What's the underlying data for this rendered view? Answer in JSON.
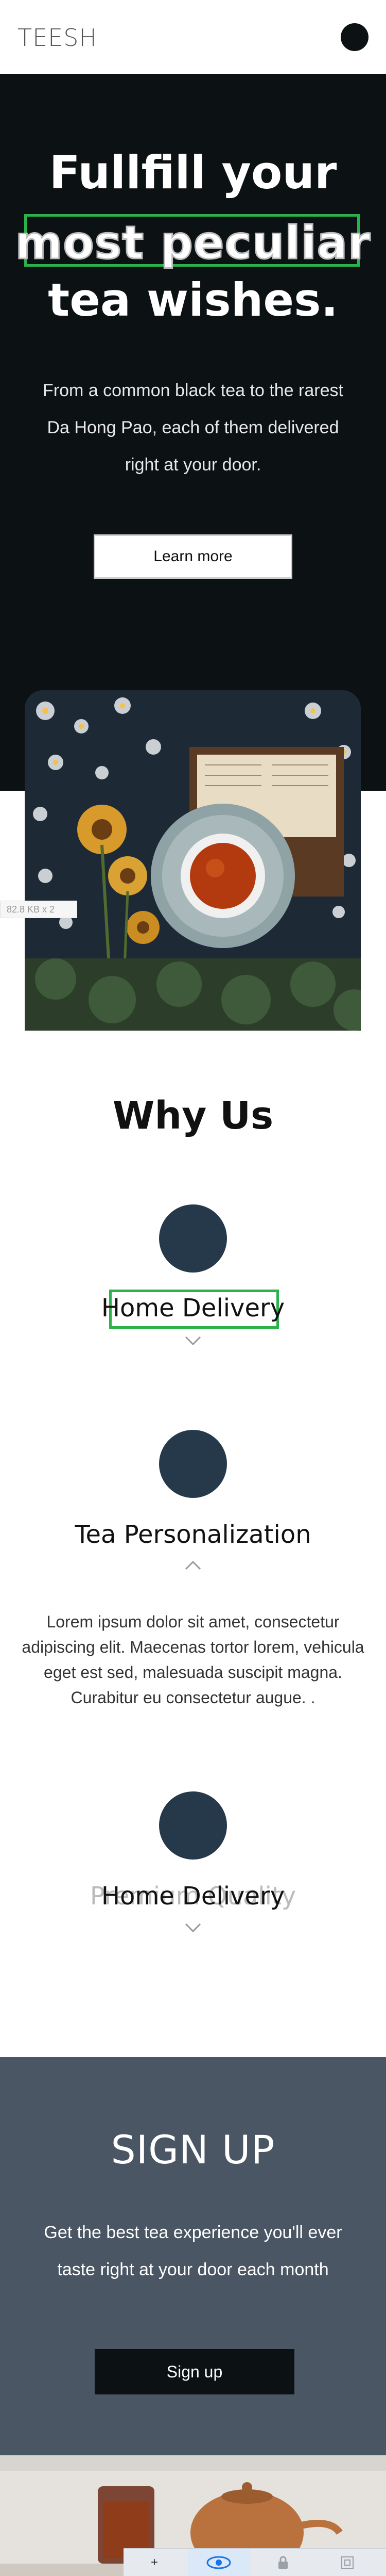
{
  "header": {
    "logo": "TEESH",
    "menu_icon": "circle-menu-icon"
  },
  "hero": {
    "title_line1": "Fullfill your",
    "title_line2": "most  peculiar",
    "title_line3": "tea wishes.",
    "subtitle": "From a common black tea to the rarest Da Hong Pao, each of them delivered right at your door.",
    "cta_label": "Learn more"
  },
  "overlay": {
    "size_label": "82.8 KB x 2"
  },
  "why_us": {
    "title": "Why Us",
    "features": [
      {
        "title": "Home Delivery",
        "expanded": false
      },
      {
        "title": "Tea Personalization",
        "expanded": true,
        "description": "Lorem ipsum dolor sit amet, consectetur adipiscing elit. Maecenas tortor lorem, vehicula eget est sed, malesuada suscipit magna. Curabitur eu consectetur augue. ."
      },
      {
        "title": "Home Delivery",
        "ghost_title": "Premium Quality",
        "expanded": false
      }
    ]
  },
  "signup": {
    "title": "SIGN UP",
    "subtitle": "Get the best tea experience you'll ever taste right at your door each month",
    "button_label": "Sign up"
  },
  "toolbar": {
    "items": [
      {
        "icon": "plus-icon",
        "glyph": "+"
      },
      {
        "icon": "eye-icon",
        "glyph": ""
      },
      {
        "icon": "lock-icon",
        "glyph": ""
      },
      {
        "icon": "layers-icon",
        "glyph": ""
      }
    ]
  },
  "colors": {
    "dark": "#0c1114",
    "accent_circle": "#26394a",
    "signup_bg": "#4a5663",
    "selection_green": "#2bb24c"
  }
}
